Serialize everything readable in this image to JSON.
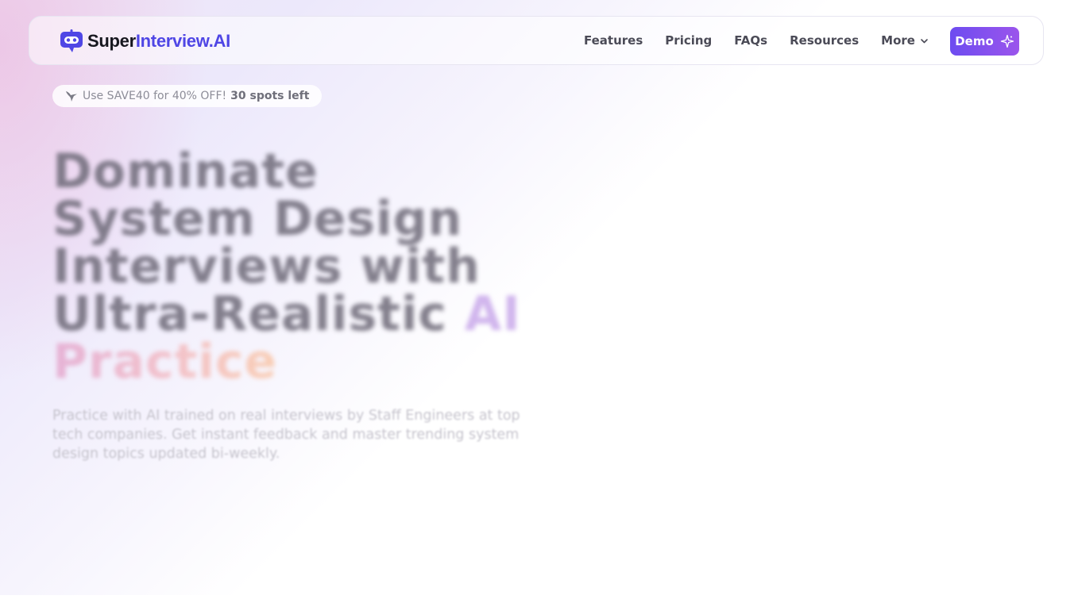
{
  "brand": {
    "name_part1": "Super",
    "name_part2": "Interview.AI",
    "logo_icon": "robot-chat-icon",
    "accent_color": "#4f46e5"
  },
  "nav": {
    "links": [
      "Features",
      "Pricing",
      "FAQs",
      "Resources"
    ],
    "more_label": "More",
    "more_icon": "chevron-down-icon",
    "demo_label": "Demo",
    "demo_icon": "sparkle-icon"
  },
  "promo": {
    "icon": "hummingbird-icon",
    "text": "Use SAVE40 for 40% OFF!",
    "highlight": "30 spots left"
  },
  "hero": {
    "headline_lines": [
      "Dominate",
      "System Design",
      "Interviews with",
      "Ultra-Realistic "
    ],
    "headline_accent_1": "AI",
    "headline_accent_2": "Practice",
    "subtitle": "Practice with AI trained on real interviews by Staff Engineers at top tech companies. Get instant feedback and master trending system design topics updated bi-weekly."
  },
  "colors": {
    "demo_gradient_start": "#6d4cf0",
    "demo_gradient_end": "#9b55ec",
    "headline_text": "#6e6a78"
  }
}
